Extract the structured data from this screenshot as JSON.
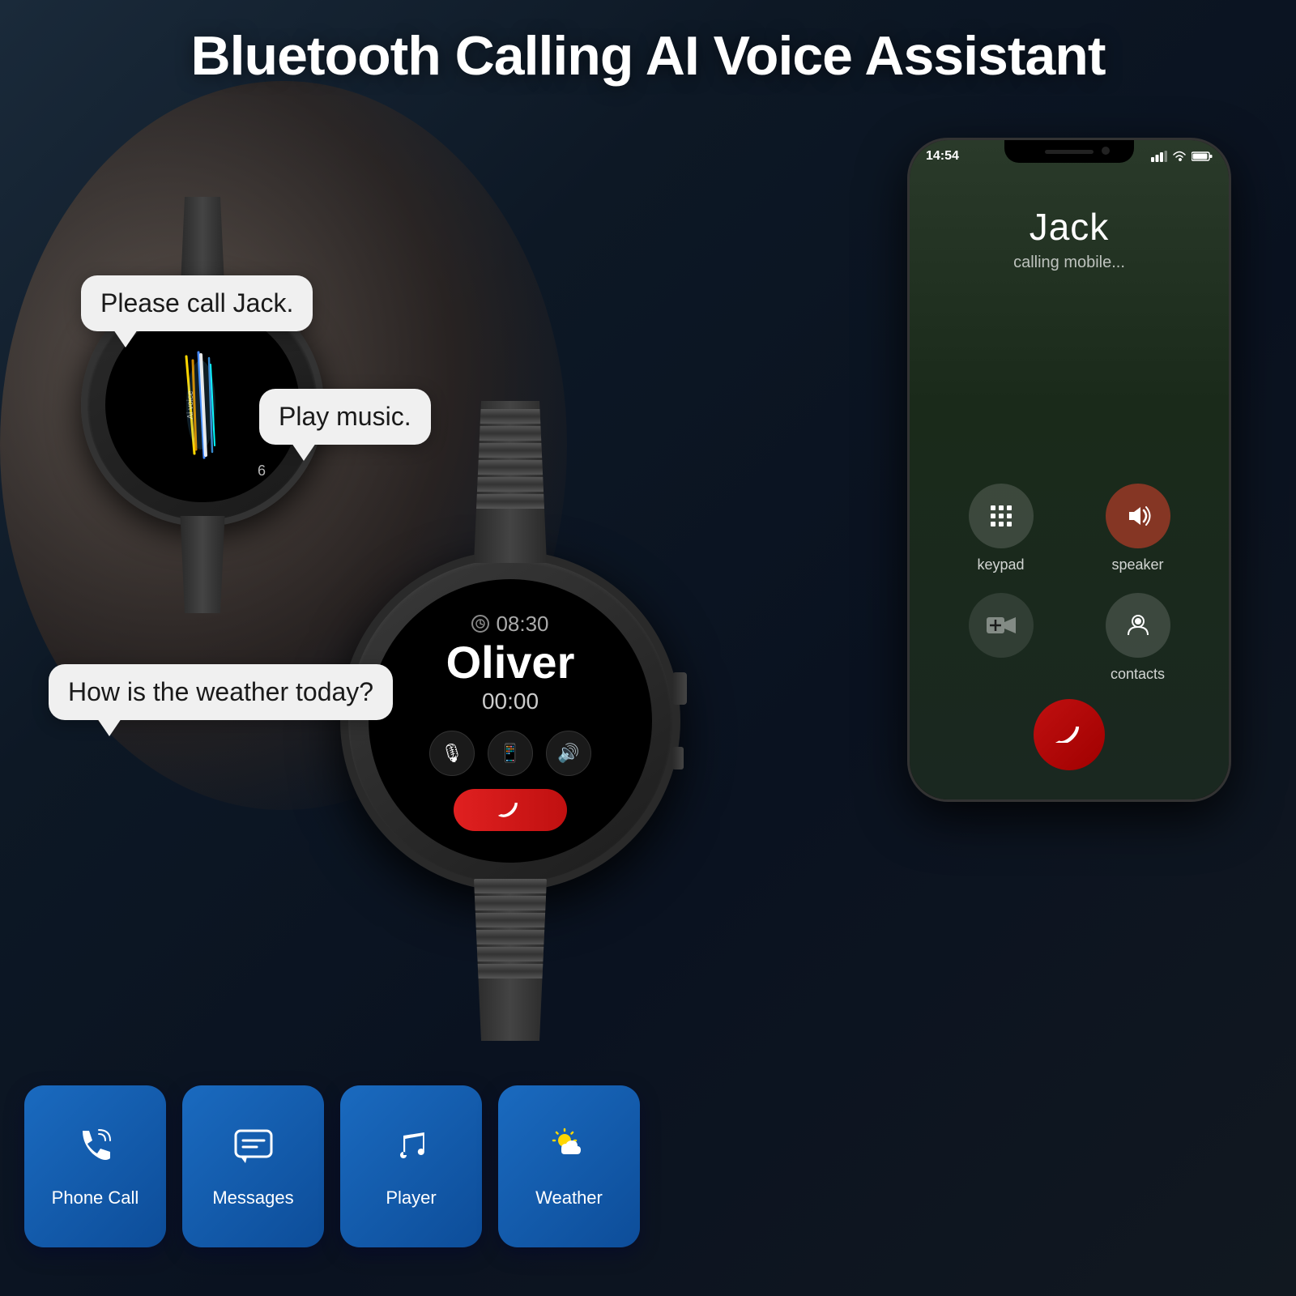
{
  "page": {
    "title": "Bluetooth Calling AI Voice Assistant",
    "background": "#0a1628"
  },
  "bubbles": {
    "call": "Please call Jack.",
    "music": "Play music.",
    "weather": "How is the weather today?"
  },
  "watch_small": {
    "label": "Ai voice",
    "number": "6"
  },
  "watch_main": {
    "time": "08:30",
    "name": "Oliver",
    "duration": "00:00",
    "end_call": "📞"
  },
  "phone": {
    "status_time": "14:54",
    "caller_name": "Jack",
    "caller_status": "calling mobile...",
    "controls": {
      "keypad": "keypad",
      "speaker": "speaker",
      "contacts": "contacts"
    }
  },
  "features": [
    {
      "id": "phone-call",
      "label": "Phone Call",
      "icon": "📞"
    },
    {
      "id": "messages",
      "label": "Messages",
      "icon": "💬"
    },
    {
      "id": "player",
      "label": "Player",
      "icon": "🎵"
    },
    {
      "id": "weather",
      "label": "Weather",
      "icon": "⛅"
    }
  ]
}
